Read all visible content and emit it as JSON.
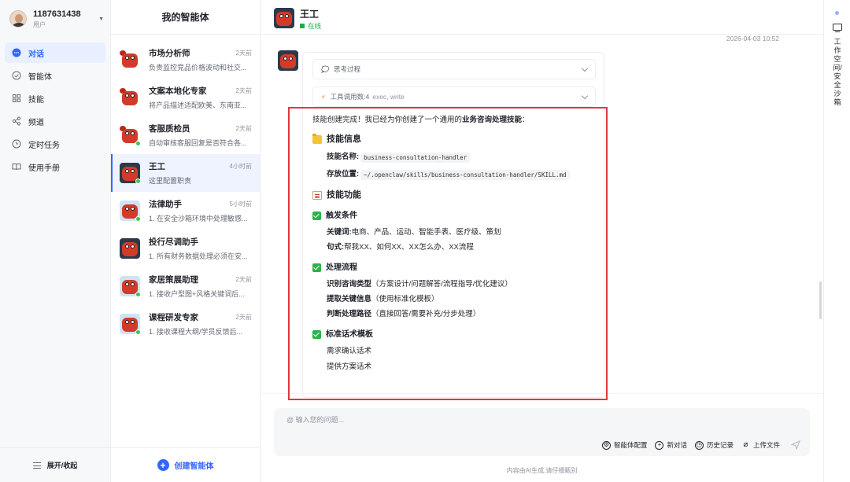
{
  "user": {
    "id": "1187631438",
    "role": "用户"
  },
  "nav": {
    "items": [
      {
        "label": "对话",
        "icon": "chat-icon",
        "active": true
      },
      {
        "label": "智能体",
        "icon": "agent-icon",
        "active": false
      },
      {
        "label": "技能",
        "icon": "grid-icon",
        "active": false
      },
      {
        "label": "频道",
        "icon": "share-icon",
        "active": false
      },
      {
        "label": "定时任务",
        "icon": "clock-icon",
        "active": false
      },
      {
        "label": "使用手册",
        "icon": "book-icon",
        "active": false
      }
    ],
    "toggle_label": "展开/收起"
  },
  "agents": {
    "title": "我的智能体",
    "items": [
      {
        "name": "市场分析师",
        "time": "2天前",
        "desc": "负责监控竞品价格波动和社交..."
      },
      {
        "name": "文案本地化专家",
        "time": "2天前",
        "desc": "将产品描述适配欧美、东南亚..."
      },
      {
        "name": "客服质检员",
        "time": "2天前",
        "desc": "自动审核客服回复是否符合各..."
      },
      {
        "name": "王工",
        "time": "4小时前",
        "desc": "这里配置职责",
        "active": true
      },
      {
        "name": "法律助手",
        "time": "5小时前",
        "desc": "1. 在安全沙箱环境中处理敏感..."
      },
      {
        "name": "投行尽调助手",
        "time": "",
        "desc": "1. 所有财务数据处理必须在安..."
      },
      {
        "name": "家居策展助理",
        "time": "2天前",
        "desc": "1. 接收户型图+风格关键词后..."
      },
      {
        "name": "课程研发专家",
        "time": "2天前",
        "desc": "1. 接收课程大纲/学员反馈后..."
      }
    ],
    "create_label": "创建智能体"
  },
  "chat": {
    "name": "王工",
    "status": "在线",
    "timestamp": "2026-04-03 10:52",
    "thinking_label": "思考过程",
    "tool_label": "工具调用数:4",
    "tool_detail": "exec, write",
    "intro_prefix": "技能创建完成！我已经为你创建了一个通用的",
    "intro_bold": "业务咨询处理技能",
    "intro_suffix": "：",
    "info_heading": "技能信息",
    "name_key": "技能名称:",
    "name_value": "business-consultation-handler",
    "path_key": "存放位置:",
    "path_value": "~/.openclaw/skills/business-consultation-handler/SKILL.md",
    "func_heading": "技能功能",
    "trigger_heading": "触发条件",
    "keywords_key": "关键词:",
    "keywords_value": "电商、产品、运动、智能手表、医疗级、策划",
    "sentence_key": "句式:",
    "sentence_value": "帮我XX、如何XX、XX怎么办、XX流程",
    "flow_heading": "处理流程",
    "flow_items": [
      {
        "bold": "识别咨询类型",
        "rest": "（方案设计/问题解答/流程指导/优化建议）"
      },
      {
        "bold": "提取关键信息",
        "rest": "（使用标准化模板）"
      },
      {
        "bold": "判断处理路径",
        "rest": "（直接回答/需要补充/分步处理）"
      }
    ],
    "script_heading": "标准话术模板",
    "script_items": [
      "需求确认话术",
      "提供方案话术"
    ]
  },
  "composer": {
    "placeholder": "@ 输入您的问题...",
    "tools": [
      "智能体配置",
      "新对话",
      "历史记录",
      "上传文件"
    ],
    "disclaimer": "内容由AI生成,请仔细甄别"
  },
  "rail": {
    "label": "工作空间/安全沙箱"
  },
  "colors": {
    "accent": "#3366ff",
    "online": "#2aa745",
    "highlight": "#e0393e"
  }
}
